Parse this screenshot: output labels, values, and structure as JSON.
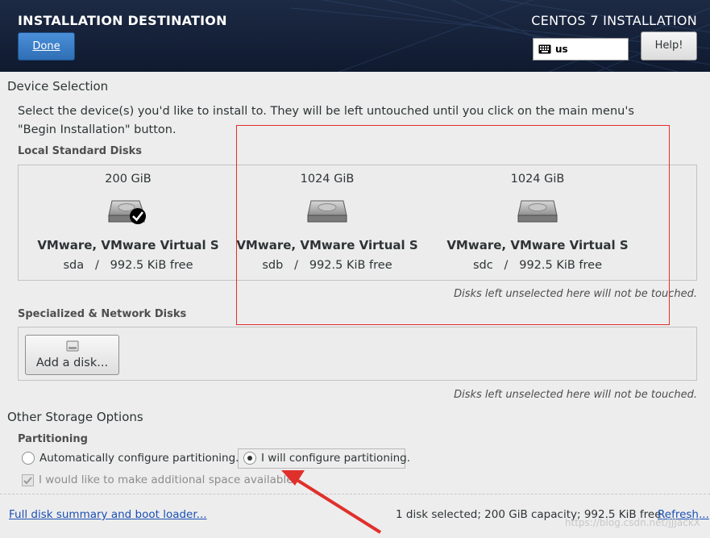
{
  "header": {
    "title": "INSTALLATION DESTINATION",
    "product": "CENTOS 7 INSTALLATION",
    "done_label": "Done",
    "keyboard_layout": "us",
    "help_label": "Help!"
  },
  "device_selection": {
    "heading": "Device Selection",
    "intro_line1": "Select the device(s) you'd like to install to.  They will be left untouched until you click on the main menu's",
    "intro_line2": "\"Begin Installation\" button.",
    "local_disks_label": "Local Standard Disks",
    "disks": [
      {
        "size": "200 GiB",
        "model": "VMware, VMware Virtual S",
        "free": "sda   /   992.5 KiB free",
        "selected": true
      },
      {
        "size": "1024 GiB",
        "model": "VMware, VMware Virtual S",
        "free": "sdb   /   992.5 KiB free",
        "selected": false
      },
      {
        "size": "1024 GiB",
        "model": "VMware, VMware Virtual S",
        "free": "sdc   /   992.5 KiB free",
        "selected": false
      }
    ],
    "untouched_note": "Disks left unselected here will not be touched.",
    "specialized_label": "Specialized & Network Disks",
    "add_disk_label": "Add a disk...",
    "untouched_note_2": "Disks left unselected here will not be touched."
  },
  "other_storage": {
    "heading": "Other Storage Options",
    "partitioning_label": "Partitioning",
    "auto_option": "Automatically configure partitioning.",
    "manual_option": "I will configure partitioning.",
    "manual_selected": true,
    "extra_space_option": "I would like to make additional space available."
  },
  "footer": {
    "summary_link": "Full disk summary and boot loader...",
    "status": "1 disk selected; 200 GiB capacity; 992.5 KiB free",
    "refresh_link": "Refresh...",
    "watermark": "https://blog.csdn.net/JJJackX"
  },
  "colors": {
    "header_bg": "#0f1a2f",
    "accent": "#2f6fb5",
    "annotation": "#e0302c",
    "link": "#1a4fb5"
  }
}
